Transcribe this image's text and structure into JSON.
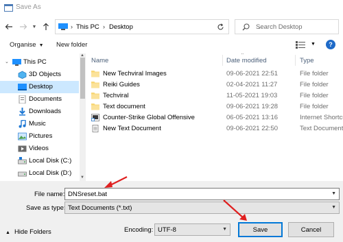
{
  "window": {
    "title": "Save As"
  },
  "address": {
    "crumbs": [
      "This PC",
      "Desktop"
    ],
    "search_placeholder": "Search Desktop"
  },
  "toolbar": {
    "organise": "Organise",
    "new_folder": "New folder"
  },
  "nav": {
    "items": [
      {
        "label": "This PC",
        "icon": "pc-icon",
        "selected": false
      },
      {
        "label": "3D Objects",
        "icon": "3d-objects-icon",
        "selected": false
      },
      {
        "label": "Desktop",
        "icon": "desktop-icon",
        "selected": true
      },
      {
        "label": "Documents",
        "icon": "documents-icon",
        "selected": false
      },
      {
        "label": "Downloads",
        "icon": "downloads-icon",
        "selected": false
      },
      {
        "label": "Music",
        "icon": "music-icon",
        "selected": false
      },
      {
        "label": "Pictures",
        "icon": "pictures-icon",
        "selected": false
      },
      {
        "label": "Videos",
        "icon": "videos-icon",
        "selected": false
      },
      {
        "label": "Local Disk (C:)",
        "icon": "drive-icon",
        "selected": false
      },
      {
        "label": "Local Disk (D:)",
        "icon": "drive-icon",
        "selected": false
      }
    ]
  },
  "list": {
    "columns": {
      "name": "Name",
      "date": "Date modified",
      "type": "Type"
    },
    "rows": [
      {
        "name": "New Techviral Images",
        "date": "09-06-2021 22:51",
        "type": "File folder",
        "icon": "folder-icon"
      },
      {
        "name": "Reiki Guides",
        "date": "02-04-2021 11:27",
        "type": "File folder",
        "icon": "folder-icon"
      },
      {
        "name": "Techviral",
        "date": "11-05-2021 19:03",
        "type": "File folder",
        "icon": "folder-icon"
      },
      {
        "name": "Text document",
        "date": "09-06-2021 19:28",
        "type": "File folder",
        "icon": "folder-icon"
      },
      {
        "name": "Counter-Strike Global Offensive",
        "date": "06-05-2021 13:16",
        "type": "Internet Shortcut",
        "icon": "shortcut-icon"
      },
      {
        "name": "New Text Document",
        "date": "09-06-2021 22:50",
        "type": "Text Document",
        "icon": "text-file-icon"
      }
    ]
  },
  "form": {
    "file_name_label": "File name:",
    "file_name_value": "DNSreset.bat",
    "save_as_type_label": "Save as type:",
    "save_as_type_value": "Text Documents (*.txt)",
    "encoding_label": "Encoding:",
    "encoding_value": "UTF-8",
    "save_label": "Save",
    "cancel_label": "Cancel",
    "hide_folders": "Hide Folders"
  },
  "colors": {
    "selection": "#cce8ff",
    "accent": "#0078d7",
    "annotation": "#e02020",
    "folder": "#f8d775"
  }
}
